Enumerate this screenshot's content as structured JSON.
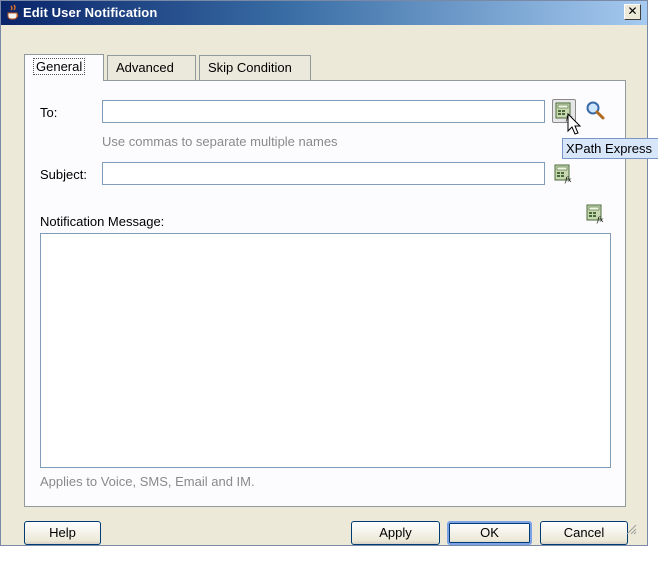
{
  "window": {
    "title": "Edit User Notification",
    "close_glyph": "✕"
  },
  "tabs": [
    {
      "label": "General",
      "active": true
    },
    {
      "label": "Advanced",
      "active": false
    },
    {
      "label": "Skip Condition",
      "active": false
    }
  ],
  "form": {
    "to_label": "To:",
    "to_value": "",
    "to_hint": "Use commas to separate multiple names",
    "subject_label": "Subject:",
    "subject_value": "",
    "message_label": "Notification Message:",
    "message_value": "",
    "message_hint": "Applies to Voice, SMS, Email and IM."
  },
  "tooltip": "XPath Express",
  "buttons": {
    "help": "Help",
    "apply": "Apply",
    "ok": "OK",
    "cancel": "Cancel"
  },
  "icons": {
    "title": "java-coffee-icon",
    "xpath": "xpath-expression-icon",
    "search": "magnifier-icon",
    "cursor": "mouse-pointer-icon"
  },
  "colors": {
    "titlebar_start": "#0a246a",
    "titlebar_end": "#a6caf0",
    "dialog_bg": "#ece9d8",
    "tooltip_bg": "#d8e6fa"
  }
}
